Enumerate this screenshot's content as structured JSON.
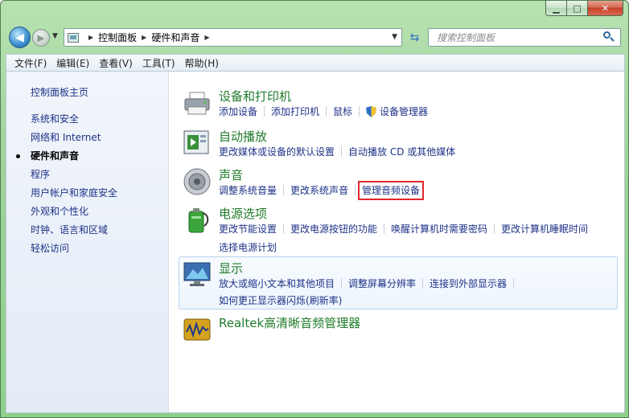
{
  "window": {
    "minimize_glyph": "▁",
    "maximize_glyph": "□",
    "close_glyph": "✕"
  },
  "nav": {
    "back_glyph": "◀",
    "forward_glyph": "▶",
    "breadcrumb": [
      "控制面板",
      "硬件和声音"
    ],
    "search_placeholder": "搜索控制面板"
  },
  "menubar": [
    "文件(F)",
    "编辑(E)",
    "查看(V)",
    "工具(T)",
    "帮助(H)"
  ],
  "sidebar": {
    "home": "控制面板主页",
    "items": [
      {
        "label": "系统和安全",
        "active": false
      },
      {
        "label": "网络和 Internet",
        "active": false
      },
      {
        "label": "硬件和声音",
        "active": true
      },
      {
        "label": "程序",
        "active": false
      },
      {
        "label": "用户帐户和家庭安全",
        "active": false
      },
      {
        "label": "外观和个性化",
        "active": false
      },
      {
        "label": "时钟、语言和区域",
        "active": false
      },
      {
        "label": "轻松访问",
        "active": false
      }
    ]
  },
  "categories": {
    "devices": {
      "title": "设备和打印机",
      "icon": "printer-icon",
      "links": [
        "添加设备",
        "添加打印机",
        "鼠标",
        "设备管理器"
      ]
    },
    "autoplay": {
      "title": "自动播放",
      "icon": "autoplay-icon",
      "links": [
        "更改媒体或设备的默认设置",
        "自动播放 CD 或其他媒体"
      ]
    },
    "sound": {
      "title": "声音",
      "icon": "speaker-icon",
      "links": [
        "调整系统音量",
        "更改系统声音",
        "管理音频设备"
      ]
    },
    "power": {
      "title": "电源选项",
      "icon": "battery-icon",
      "links": [
        "更改节能设置",
        "更改电源按钮的功能",
        "唤醒计算机时需要密码",
        "更改计算机睡眠时间",
        "选择电源计划"
      ]
    },
    "display": {
      "title": "显示",
      "icon": "monitor-icon",
      "links": [
        "放大或缩小文本和其他项目",
        "调整屏幕分辨率",
        "连接到外部显示器",
        "如何更正显示器闪烁(刷新率)"
      ]
    },
    "realtek": {
      "title": "Realtek高清晰音频管理器",
      "icon": "realtek-audio-icon"
    }
  },
  "colors": {
    "link": "#1e3287",
    "category_title": "#1f7a2a",
    "highlight_box": "#e0282e"
  }
}
